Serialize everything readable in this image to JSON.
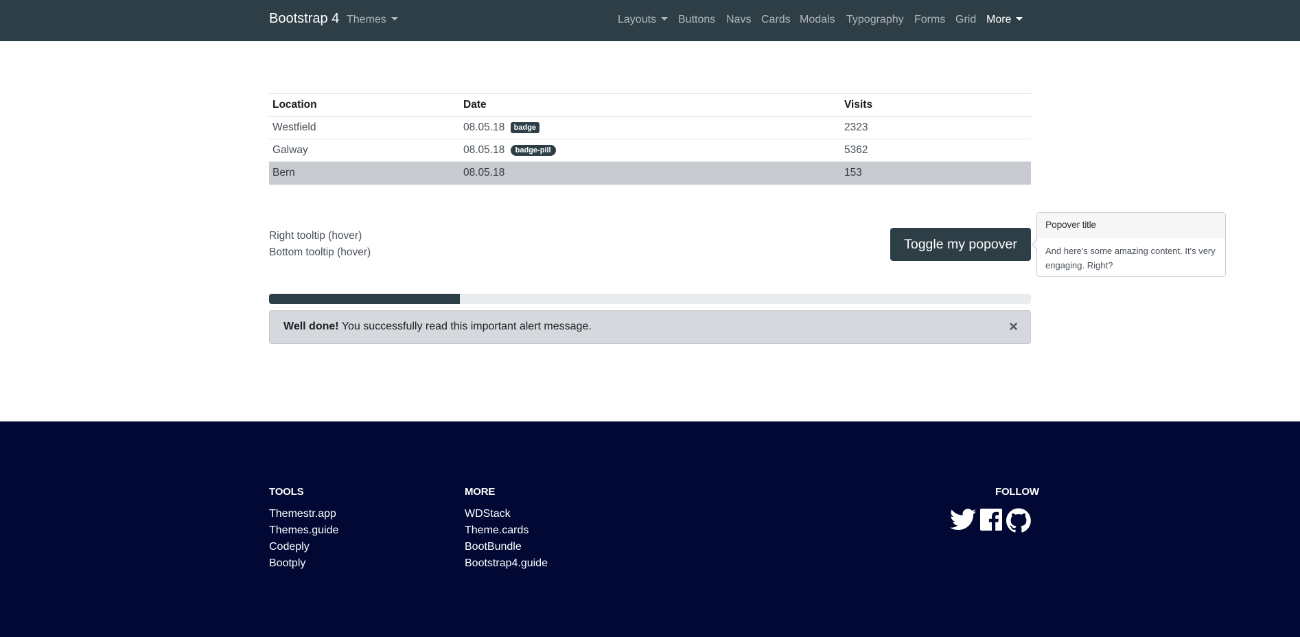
{
  "navbar": {
    "brand": "Bootstrap 4",
    "themes": "Themes",
    "items": [
      "Layouts",
      "Buttons",
      "Navs",
      "Cards",
      "Modals",
      "Typography",
      "Forms",
      "Grid",
      "More"
    ]
  },
  "table": {
    "headers": [
      "Location",
      "Date",
      "Visits"
    ],
    "rows": [
      {
        "location": "Westfield",
        "date": "08.05.18",
        "badge": "badge",
        "visits": "2323"
      },
      {
        "location": "Galway",
        "date": "08.05.18",
        "badge": "badge-pill",
        "visits": "5362"
      },
      {
        "location": "Bern",
        "date": "08.05.18",
        "badge": "",
        "visits": "153"
      }
    ]
  },
  "tooltips": {
    "right": "Right tooltip (hover)",
    "bottom": "Bottom tooltip (hover)"
  },
  "popover": {
    "button": "Toggle my popover",
    "title": "Popover title",
    "body": "And here's some amazing content. It's very engaging. Right?"
  },
  "progress": {
    "value_percent": 25
  },
  "alert": {
    "strong": "Well done!",
    "text": " You successfully read this important alert message.",
    "close": "×"
  },
  "footer": {
    "tools_heading": "TOOLS",
    "tools": [
      "Themestr.app",
      "Themes.guide",
      "Codeply",
      "Bootply"
    ],
    "more_heading": "MORE",
    "more": [
      "WDStack",
      "Theme.cards",
      "BootBundle",
      "Bootstrap4.guide"
    ],
    "follow_heading": "FOLLOW",
    "social_icons": [
      "twitter-icon",
      "facebook-icon",
      "github-icon"
    ]
  },
  "colors": {
    "navbar": "#2e3e47",
    "footer": "#000833",
    "alert": "#d5d8dc"
  }
}
